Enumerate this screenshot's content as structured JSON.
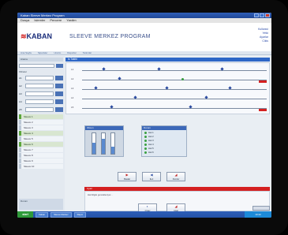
{
  "window": {
    "title": "Kaban Sleeve Merkez Program"
  },
  "menu": [
    "Dosya",
    "Islemler",
    "Pencere",
    "Yardim"
  ],
  "header": {
    "logo_text": "KABAN",
    "app_title": "SLEEVE MERKEZ PROGRAM",
    "right_links": [
      "Kullanici",
      "Yetki",
      "Ayarlar",
      "Cikis"
    ]
  },
  "navbar": [
    "Ana Sayfa",
    "Siparisler",
    "Uretim",
    "Raporlar",
    "Tanimlar"
  ],
  "sidebar": {
    "search_title": "Arama",
    "group_title": "Filtreler",
    "rows": [
      "A1",
      "A2",
      "A3",
      "A4",
      "A5"
    ],
    "items": [
      "Sleeve 1",
      "Sleeve 2",
      "Sleeve 3",
      "Sleeve 4",
      "Sleeve 5",
      "Sleeve 6",
      "Sleeve 7",
      "Sleeve 8",
      "Sleeve 9",
      "Sleeve 10"
    ],
    "bottom_text": "Durum"
  },
  "main": {
    "section_title": "Is Takibi",
    "timeline_rows": [
      {
        "label": "L1"
      },
      {
        "label": "L2"
      },
      {
        "label": "L3"
      },
      {
        "label": "L4"
      },
      {
        "label": "L5"
      }
    ],
    "panel_left_title": "Olcum",
    "gauge_levels": [
      0.55,
      0.75,
      0.35
    ],
    "panel_right_title": "Durum",
    "legend": [
      "Hat 1",
      "Hat 2",
      "Hat 3",
      "Hat 4",
      "Hat 5",
      "Hat 6"
    ],
    "buttons": [
      {
        "label": "Baslat",
        "icon": "play-icon"
      },
      {
        "label": "Ileri",
        "icon": "arrow-icon"
      },
      {
        "label": "Durdur",
        "icon": "stop-icon"
      }
    ],
    "alert_title": "Uyari",
    "alert_text": "Hat bilgisi guncelleniyor...",
    "buttons2": [
      {
        "label": "Onay",
        "icon": "check-icon"
      },
      {
        "label": "Iptal",
        "icon": "cancel-icon"
      }
    ]
  },
  "taskbar": {
    "start_label": "start",
    "tasks": [
      "Kaban",
      "Sleeve Merkez",
      "Rapor"
    ],
    "clock": "10:42"
  },
  "colors": {
    "accent": "#2e67c7",
    "alert": "#d42020",
    "ok": "#3aa040"
  }
}
